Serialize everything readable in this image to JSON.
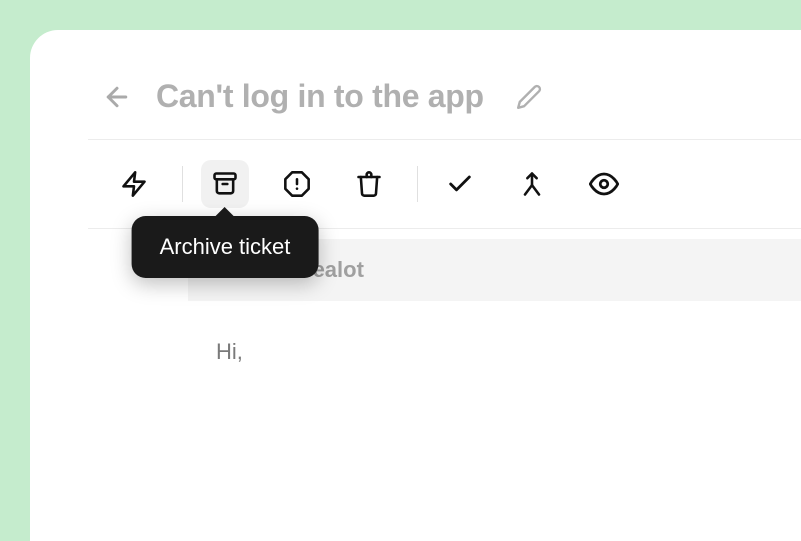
{
  "header": {
    "title": "Can't log in to the app"
  },
  "toolbar": {
    "tooltip_archive": "Archive ticket"
  },
  "message": {
    "sender": "Elliot Carealot",
    "body": "Hi,"
  }
}
